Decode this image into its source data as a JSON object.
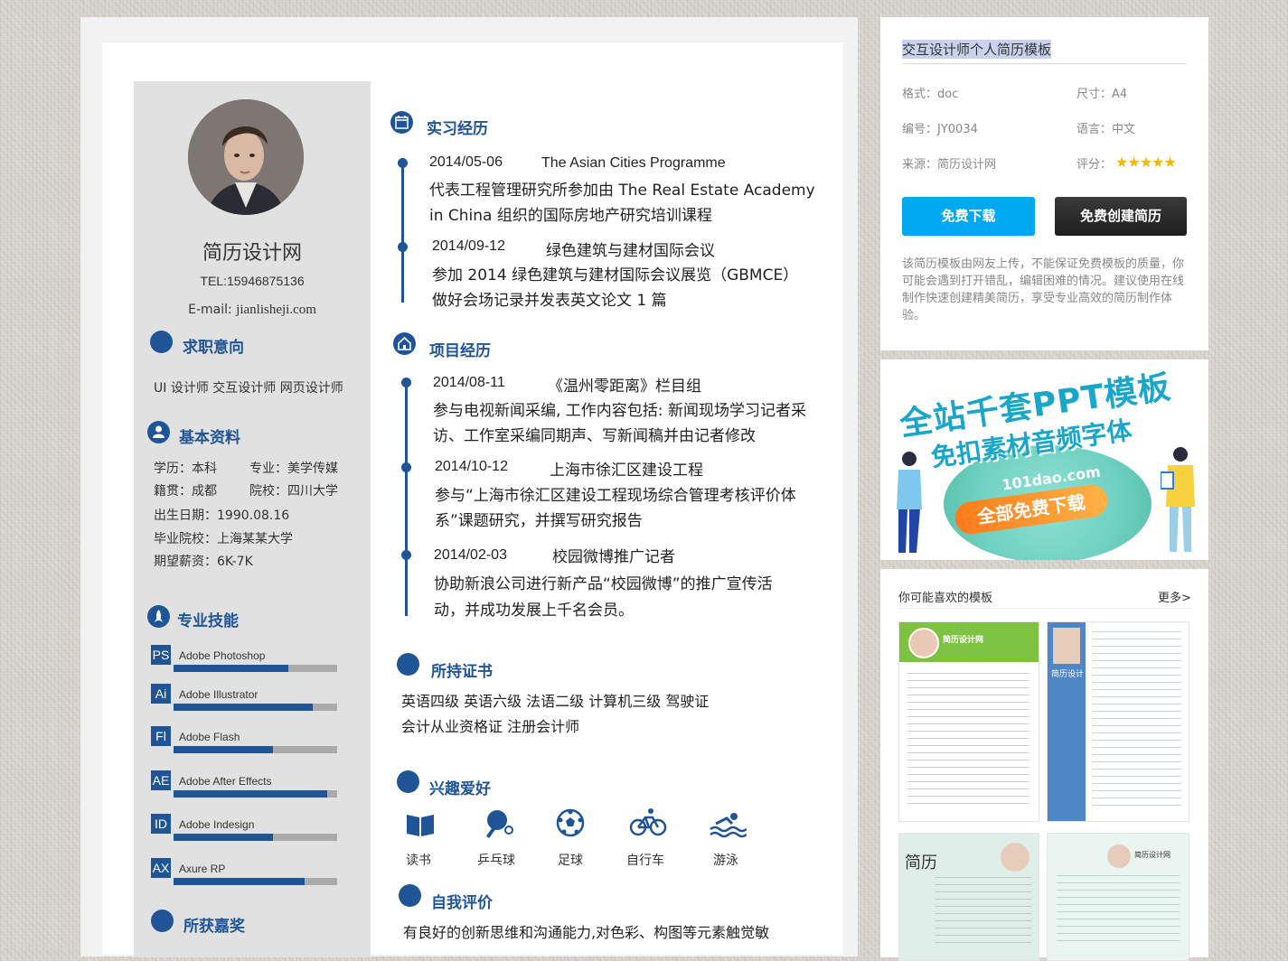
{
  "resume": {
    "name": "简历设计网",
    "tel": "TEL:15946875136",
    "email_label": "E-mail:",
    "email_value": "jianlisheji.com",
    "job_intention": {
      "title": "求职意向",
      "text": "UI 设计师  交互设计师  网页设计师"
    },
    "basic_info": {
      "title": "基本资料",
      "rows": [
        [
          "学历：本科",
          "专业：美学传媒"
        ],
        [
          "籍贯：成都",
          "院校：四川大学"
        ],
        [
          "出生日期：1990.08.16"
        ],
        [
          "毕业院校：上海某某大学"
        ],
        [
          "期望薪资：6K-7K"
        ]
      ]
    },
    "skills": {
      "title": "专业技能",
      "items": [
        {
          "badge": "PS",
          "name": "Adobe Photoshop",
          "level": 0.7
        },
        {
          "badge": "Ai",
          "name": "Adobe Illustrator",
          "level": 0.85
        },
        {
          "badge": "Fl",
          "name": "Adobe Flash",
          "level": 0.61
        },
        {
          "badge": "AE",
          "name": "Adobe After Effects",
          "level": 0.94
        },
        {
          "badge": "ID",
          "name": "Adobe Indesign",
          "level": 0.61
        },
        {
          "badge": "AX",
          "name": "Axure   RP",
          "level": 0.8
        }
      ]
    },
    "awards": {
      "title": "所获嘉奖"
    },
    "internship": {
      "title": "实习经历",
      "items": [
        {
          "date": "2014/05-06",
          "head": "The Asian Cities Programme",
          "lines": [
            "代表工程管理研究所参加由 The Real Estate Academy",
            "in China   组织的国际房地产研究培训课程"
          ]
        },
        {
          "date": "2014/09-12",
          "head": "绿色建筑与建材国际会议",
          "lines": [
            "参加 2014 绿色建筑与建材国际会议展览（GBMCE）",
            "做好会场记录并发表英文论文 1 篇"
          ]
        }
      ]
    },
    "projects": {
      "title": "项目经历",
      "items": [
        {
          "date": "2014/08-11",
          "head": "《温州零距离》栏目组",
          "lines": [
            "参与电视新闻采编, 工作内容包括: 新闻现场学习记者采",
            "访、工作室采编同期声、写新闻稿并由记者修改"
          ]
        },
        {
          "date": "2014/10-12",
          "head": "上海市徐汇区建设工程",
          "lines": [
            "参与“上海市徐汇区建设工程现场综合管理考核评价体",
            "系”课题研究，并撰写研究报告"
          ]
        },
        {
          "date": "2014/02-03",
          "head": "校园微博推广记者",
          "lines": [
            "协助新浪公司进行新产品“校园微博”的推广宣传活",
            "动，并成功发展上千名会员。"
          ]
        }
      ]
    },
    "certificates": {
      "title": "所持证书",
      "lines": [
        "英语四级    英语六级    法语二级  计算机三级    驾驶证",
        "会计从业资格证    注册会计师"
      ]
    },
    "hobbies": {
      "title": "兴趣爱好",
      "items": [
        {
          "icon": "book-icon",
          "label": "读书"
        },
        {
          "icon": "ping-pong-icon",
          "label": "乒乓球"
        },
        {
          "icon": "football-icon",
          "label": "足球"
        },
        {
          "icon": "bicycle-icon",
          "label": "自行车"
        },
        {
          "icon": "swimming-icon",
          "label": "游泳"
        }
      ]
    },
    "self_eval": {
      "title": "自我评价",
      "text": "有良好的创新思维和沟通能力,对色彩、构图等元素触觉敏"
    }
  },
  "sidebar": {
    "title": "交互设计师个人简历模板",
    "info": {
      "format_label": "格式：",
      "format_value": "doc",
      "size_label": "尺寸：",
      "size_value": "A4",
      "id_label": "编号：",
      "id_value": "JY0034",
      "lang_label": "语言：",
      "lang_value": "中文",
      "source_label": "来源：",
      "source_value": "简历设计网",
      "rating_label": "评分：",
      "rating_value": 5
    },
    "download_button": "免费下载",
    "create_button": "免费创建简历",
    "disclaimer": "该简历模板由网友上传，不能保证免费模板的质量，你可能会遇到打开错乱，编辑困难的情况。建议使用在线制作快速创建精美简历，享受专业高效的简历制作体验。",
    "ad": {
      "line1": "全站千套PPT模板",
      "line2": "免扣素材音频字体",
      "domain": "101dao.com",
      "cta": "全部免费下载"
    },
    "recommend": {
      "title": "你可能喜欢的模板",
      "more": "更多>",
      "thumb1_name": "简历设计网",
      "thumb2_name": "简历设计",
      "thumb3_name": "简历",
      "thumb4_name": "简历设计网"
    }
  },
  "colors": {
    "primary_blue": "#1f5597",
    "download_button": "#00a8f0",
    "create_button": "#2a2a2a",
    "star": "#f5b800"
  }
}
